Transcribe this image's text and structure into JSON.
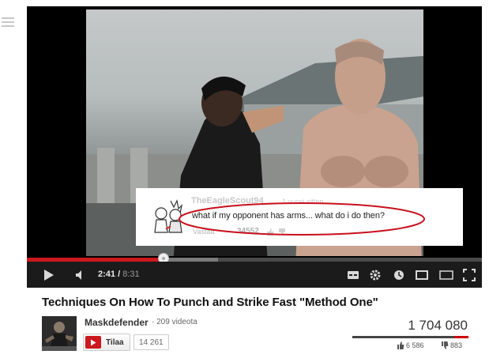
{
  "player": {
    "current_time": "2:41",
    "duration": "8:31",
    "progress_fraction": 0.3,
    "buffered_fraction": 0.42
  },
  "comment_overlay": {
    "username": "TheEagleScout94",
    "time_ago": "1 vuosi sitten",
    "text": "what if my opponent has arms... what do i do then?",
    "reply_label": "Vastaa",
    "score": "34552"
  },
  "video": {
    "title": "Techniques On How To Punch and Strike Fast \"Method One\"",
    "channel_name": "Maskdefender",
    "video_count": "209 videota",
    "subscribe_label": "Tilaa",
    "subscriber_count": "14 261",
    "view_count": "1 704 080",
    "likes": "6 586",
    "dislikes": "883",
    "like_fraction": 0.88
  },
  "colors": {
    "accent_red": "#cc181e",
    "highlight_oval": "#c8101c"
  },
  "icons": [
    "guide-icon",
    "play-icon",
    "volume-icon",
    "captions-icon",
    "settings-icon",
    "watch-later-icon",
    "small-player-icon",
    "large-player-icon",
    "fullscreen-icon",
    "thumbs-up-icon",
    "thumbs-down-icon",
    "youtube-logo-icon"
  ]
}
